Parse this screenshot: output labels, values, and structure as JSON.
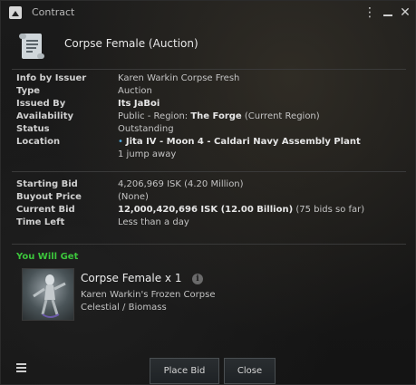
{
  "window": {
    "title": "Contract"
  },
  "header": {
    "contract_name": "Corpse Female (Auction)"
  },
  "info": {
    "info_by_issuer": {
      "label": "Info by Issuer",
      "value": "Karen Warkin Corpse Fresh"
    },
    "type": {
      "label": "Type",
      "value": "Auction"
    },
    "issued_by": {
      "label": "Issued By",
      "value": "Its JaBoi"
    },
    "availability": {
      "label": "Availability",
      "prefix": "Public - Region: ",
      "region": "The Forge",
      "suffix": " (Current Region)"
    },
    "status": {
      "label": "Status",
      "value": "Outstanding"
    },
    "location": {
      "label": "Location",
      "value": "Jita IV - Moon 4 - Caldari Navy Assembly Plant",
      "distance": "1 jump away"
    }
  },
  "bids": {
    "starting_bid": {
      "label": "Starting Bid",
      "value": "4,206,969 ISK (4.20 Million)"
    },
    "buyout_price": {
      "label": "Buyout Price",
      "value": "(None)"
    },
    "current_bid": {
      "label": "Current Bid",
      "value": "12,000,420,696 ISK (12.00 Billion)",
      "bids": " (75 bids so far)"
    },
    "time_left": {
      "label": "Time Left",
      "value": "Less than a day"
    }
  },
  "you_will_get": {
    "heading": "You Will Get",
    "item": {
      "name": "Corpse Female x 1",
      "description": "Karen Warkin's Frozen Corpse",
      "category": "Celestial / Biomass"
    }
  },
  "footer": {
    "place_bid_label": "Place Bid",
    "close_label": "Close"
  },
  "colors": {
    "accent_green": "#3cc63c",
    "location_dot": "#4fa3d8"
  },
  "icons": [
    "app-icon",
    "kebab-menu-icon",
    "minimize-icon",
    "close-icon",
    "contract-scroll-icon",
    "info-icon",
    "hamburger-menu-icon"
  ]
}
